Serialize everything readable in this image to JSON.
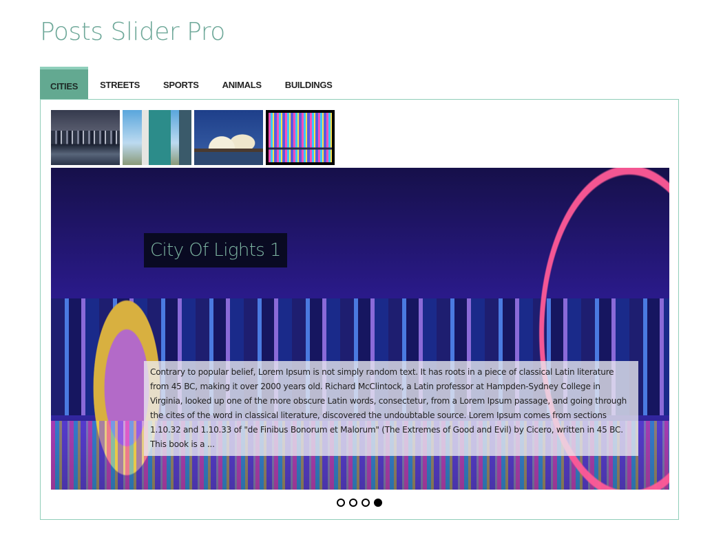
{
  "page": {
    "title": "Posts Slider Pro"
  },
  "tabs": [
    {
      "label": "CITIES",
      "active": true
    },
    {
      "label": "STREETS",
      "active": false
    },
    {
      "label": "SPORTS",
      "active": false
    },
    {
      "label": "ANIMALS",
      "active": false
    },
    {
      "label": "BUILDINGS",
      "active": false
    }
  ],
  "thumbnails": [
    {
      "name": "city-skyline-night",
      "active": false
    },
    {
      "name": "office-building",
      "active": false
    },
    {
      "name": "opera-house",
      "active": false
    },
    {
      "name": "marina-skyline",
      "active": true
    }
  ],
  "slide": {
    "title": "City Of Lights 1",
    "excerpt": "Contrary to popular belief, Lorem Ipsum is not simply random text. It has roots in a piece of classical Latin literature from 45 BC, making it over 2000 years old. Richard McClintock, a Latin professor at Hampden-Sydney College in Virginia, looked up one of the more obscure Latin words, consectetur, from a Lorem Ipsum passage, and going through the cites of the word in classical literature, discovered the undoubtable source. Lorem Ipsum comes from sections 1.10.32 and 1.10.33 of \"de Finibus Bonorum et Malorum\" (The Extremes of Good and Evil) by Cicero, written in 45 BC. This book is a ..."
  },
  "pagination": {
    "total": 4,
    "current": 4
  },
  "colors": {
    "accent": "#63a991",
    "accent_light": "#8fcdb8",
    "title": "#6ea899"
  }
}
